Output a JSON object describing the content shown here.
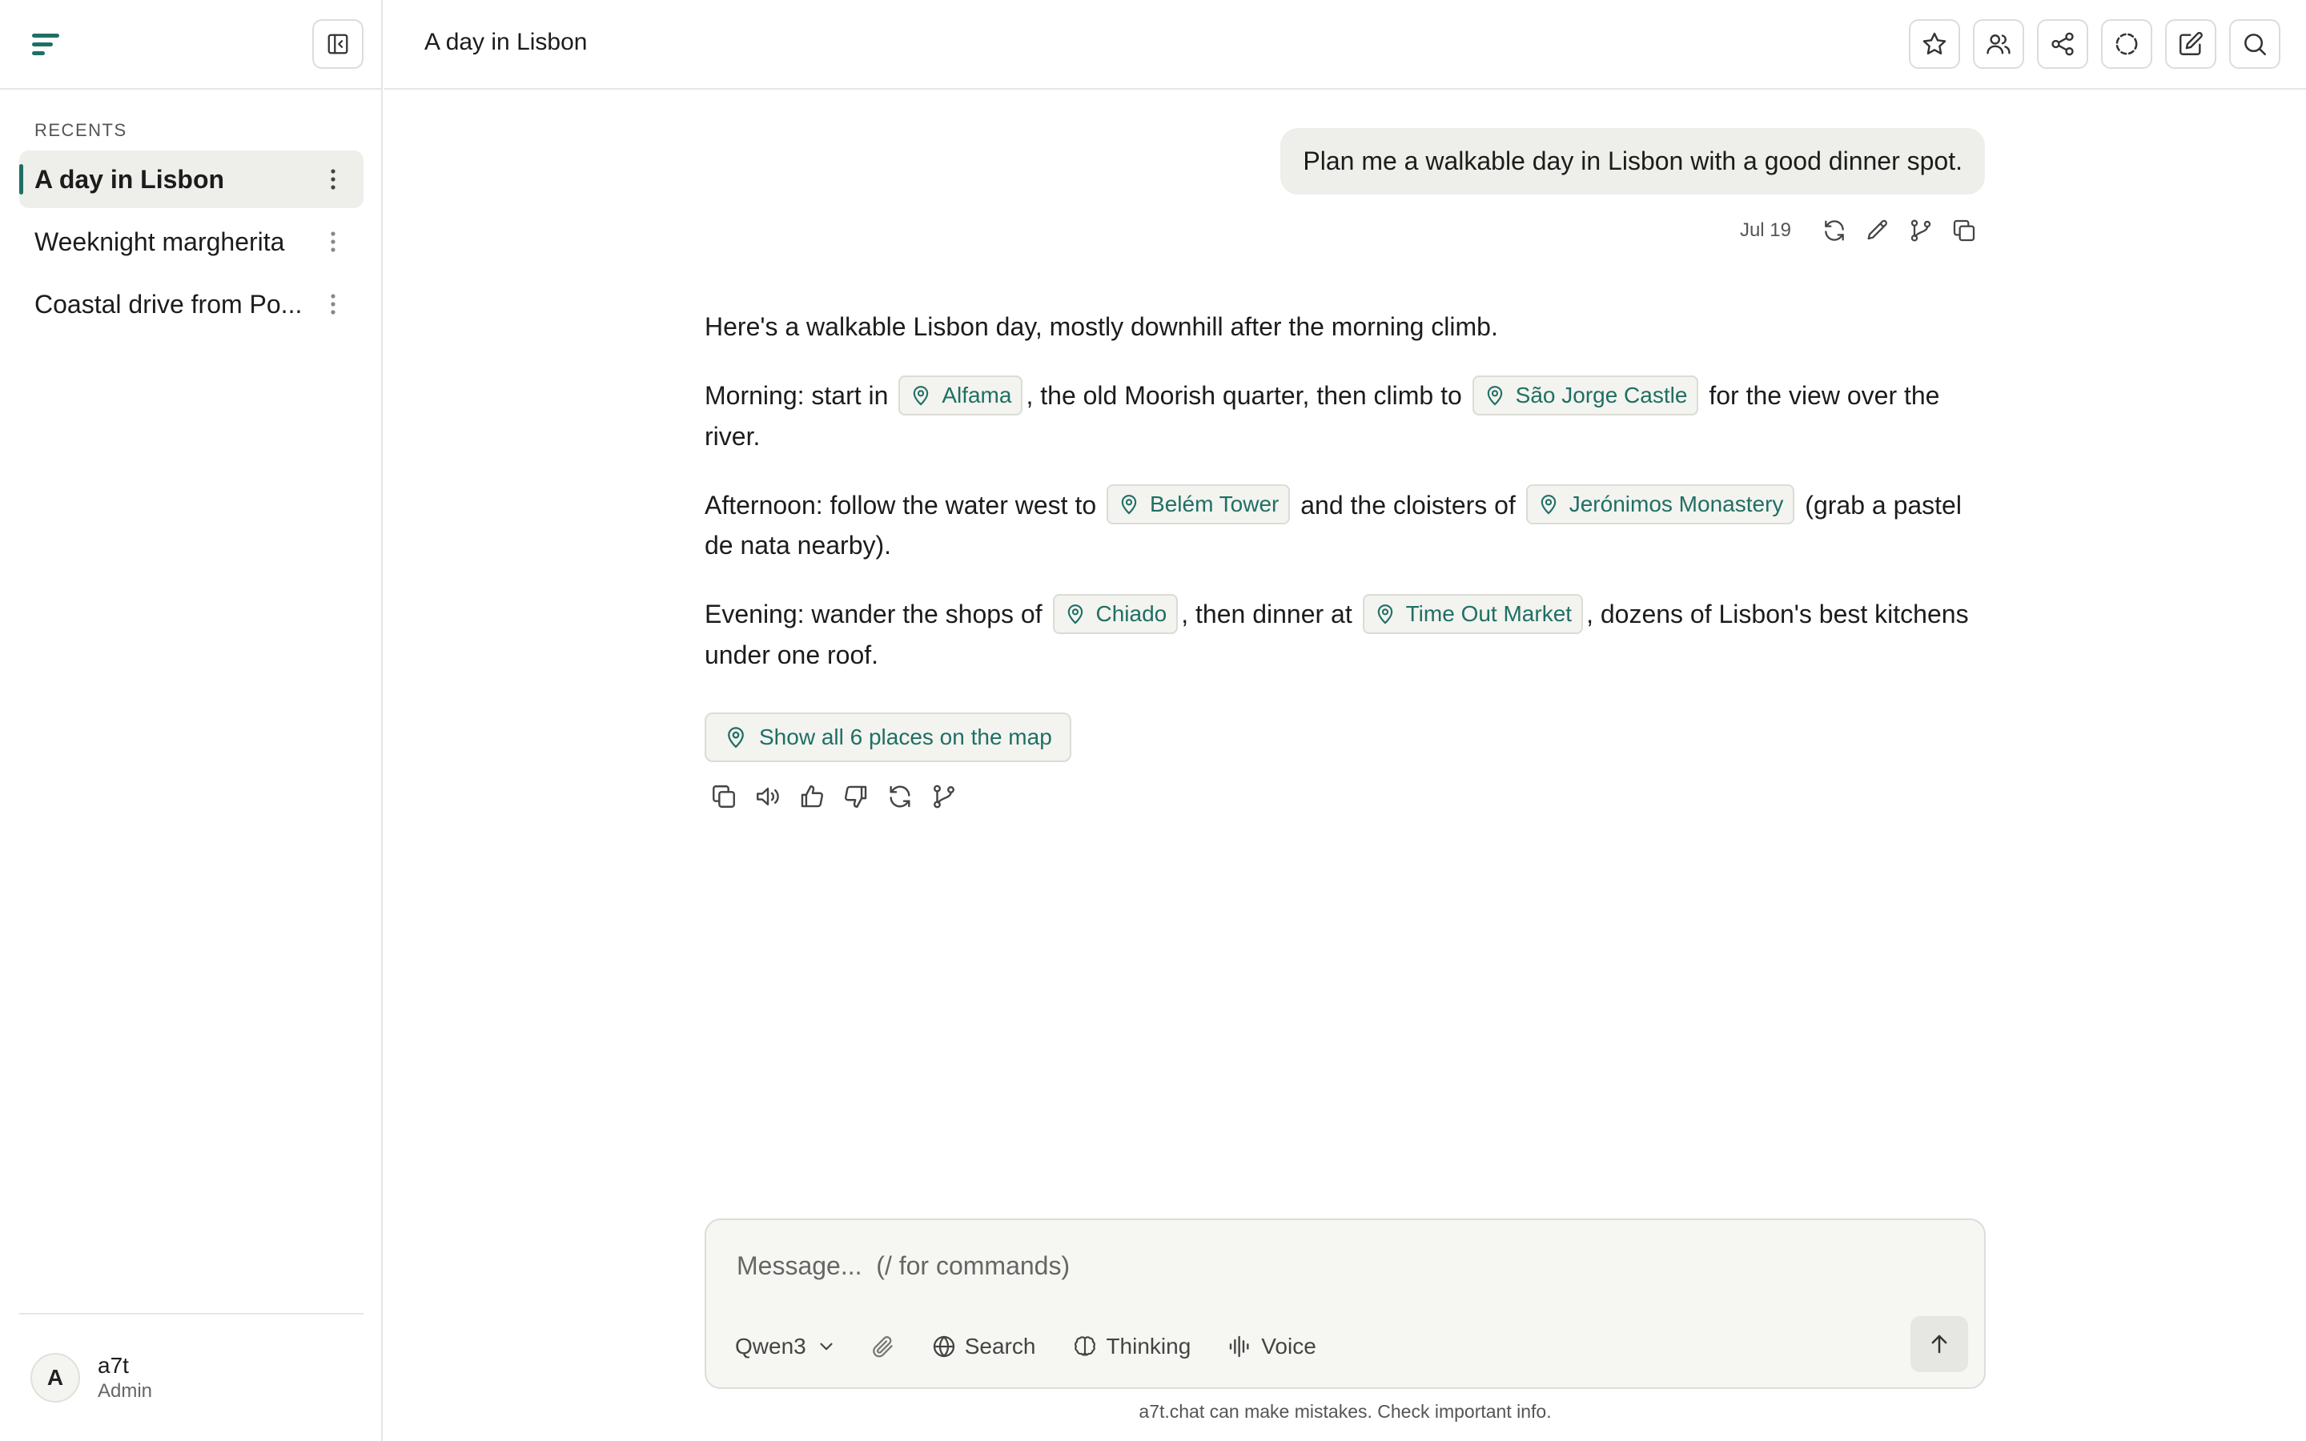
{
  "sidebar": {
    "recents_label": "RECENTS",
    "chats": [
      {
        "title": "A day in Lisbon",
        "active": true
      },
      {
        "title": "Weeknight margherita",
        "active": false
      },
      {
        "title": "Coastal drive from Po...",
        "active": false
      }
    ],
    "user": {
      "initial": "A",
      "name": "a7t",
      "role": "Admin"
    }
  },
  "header": {
    "title": "A day in Lisbon"
  },
  "conversation": {
    "user_message": "Plan me a walkable day in Lisbon with a good dinner spot.",
    "user_message_date": "Jul 19",
    "assistant": {
      "intro": "Here's a walkable Lisbon day, mostly downhill after the morning climb.",
      "morning": {
        "lead": "Morning: start in ",
        "place1": "Alfama",
        "mid": ", the old Moorish quarter, then climb to ",
        "place2": "São Jorge Castle",
        "tail": " for the view over the river."
      },
      "afternoon": {
        "lead": "Afternoon: follow the water west to ",
        "place1": "Belém Tower",
        "mid": " and the cloisters of ",
        "place2": "Jerónimos Monastery",
        "tail": " (grab a pastel de nata nearby)."
      },
      "evening": {
        "lead": "Evening: wander the shops of ",
        "place1": "Chiado",
        "mid": ", then dinner at ",
        "place2": "Time Out Market",
        "tail": ", dozens of Lisbon's best kitchens under one roof."
      },
      "map_button": "Show all 6 places on the map"
    }
  },
  "composer": {
    "placeholder": "Message...  (/ for commands)",
    "model": "Qwen3",
    "search_label": "Search",
    "thinking_label": "Thinking",
    "voice_label": "Voice"
  },
  "footer": {
    "disclaimer": "a7t.chat can make mistakes. Check important info."
  },
  "colors": {
    "accent": "#1f6f64",
    "chip_bg": "#f3f3ef",
    "bubble_bg": "#eeeeea"
  }
}
